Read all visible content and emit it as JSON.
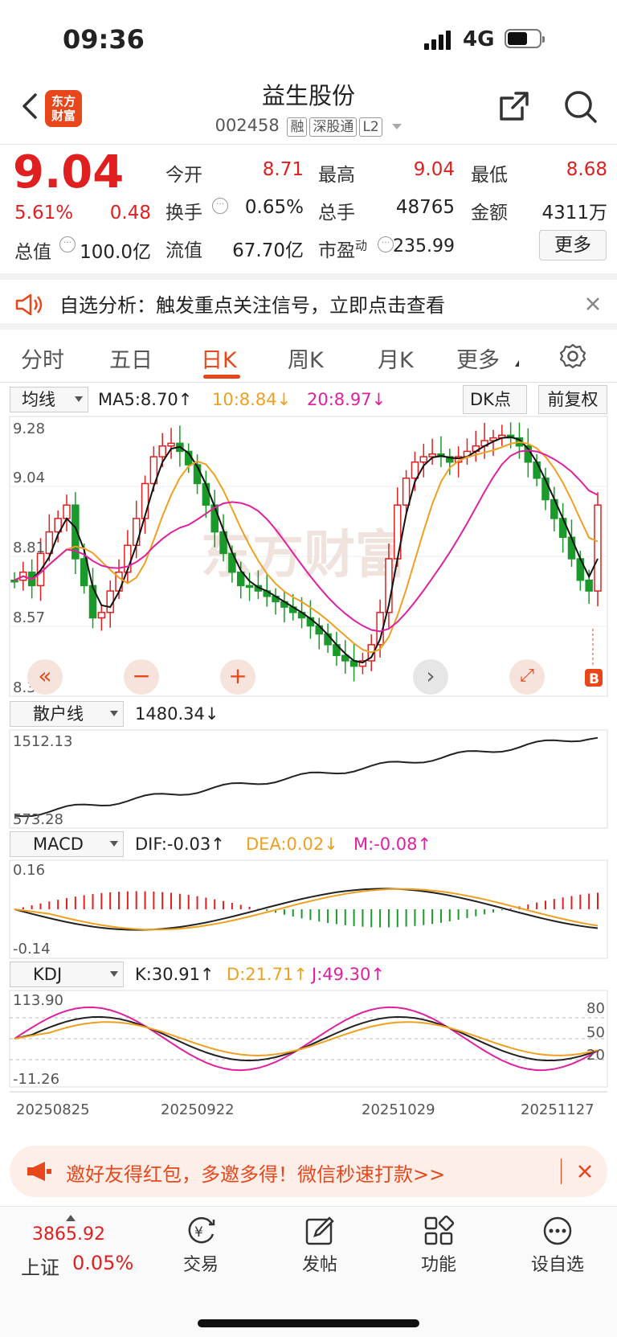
{
  "status_bar": {
    "time": "09:36",
    "network": "4G"
  },
  "header": {
    "title": "益生股份",
    "code": "002458",
    "tags": [
      "融",
      "深股通",
      "L2"
    ],
    "logo_text": "东方财富"
  },
  "quote": {
    "price": "9.04",
    "change_pct": "5.61%",
    "change_amt": "0.48",
    "open_label": "今开",
    "open": "8.71",
    "high_label": "最高",
    "high": "9.04",
    "low_label": "最低",
    "low": "8.68",
    "turnover_label": "换手",
    "turnover": "0.65%",
    "volume_label": "总手",
    "volume": "48765",
    "amount_label": "金额",
    "amount": "4311万",
    "total_mv_label": "总值",
    "total_mv": "100.0亿",
    "float_mv_label": "流值",
    "float_mv": "67.70亿",
    "pe_label": "市盈",
    "pe_sup": "动",
    "pe": "235.99",
    "more_button": "更多"
  },
  "signal_banner": {
    "text": "自选分析：触发重点关注信号，立即点击查看"
  },
  "tabs": [
    "分时",
    "五日",
    "日K",
    "周K",
    "月K",
    "更多"
  ],
  "active_tab": "日K",
  "kline": {
    "indicator": "均线",
    "ma5": "MA5:8.70",
    "ma10": "10:8.84",
    "ma20": "20:8.97",
    "dk_button": "DK点",
    "fq_button": "前复权",
    "y_labels": [
      "9.28",
      "9.04",
      "8.81",
      "8.57",
      "8.33"
    ],
    "b_marker": "B",
    "colors": {
      "up": "#e02020",
      "down": "#1a9a2a",
      "ma5": "#111111",
      "ma10": "#f0a020",
      "ma20": "#e020a0"
    }
  },
  "retail": {
    "indicator": "散户线",
    "value": "1480.34",
    "y_top": "1512.13",
    "y_bottom": "573.28"
  },
  "macd": {
    "indicator": "MACD",
    "dif": "DIF:-0.03",
    "dea": "DEA:0.02",
    "m": "M:-0.08",
    "y_top": "0.16",
    "y_bottom": "-0.14"
  },
  "kdj": {
    "indicator": "KDJ",
    "k": "K:30.91",
    "d": "D:21.71",
    "j": "J:49.30",
    "y_top": "113.90",
    "y_bottom": "-11.26",
    "levels": [
      "80",
      "50",
      "20"
    ]
  },
  "dates": [
    "20250825",
    "20250922",
    "20251029",
    "20251127"
  ],
  "promo_banner": {
    "text": "邀好友得红包，多邀多得！微信秒速打款>>"
  },
  "bottom_nav": {
    "index_value": "3865.92",
    "index_name": "上证",
    "index_change": "0.05%",
    "items": [
      "交易",
      "发帖",
      "功能",
      "设自选"
    ]
  },
  "watermark": "东方财富"
}
